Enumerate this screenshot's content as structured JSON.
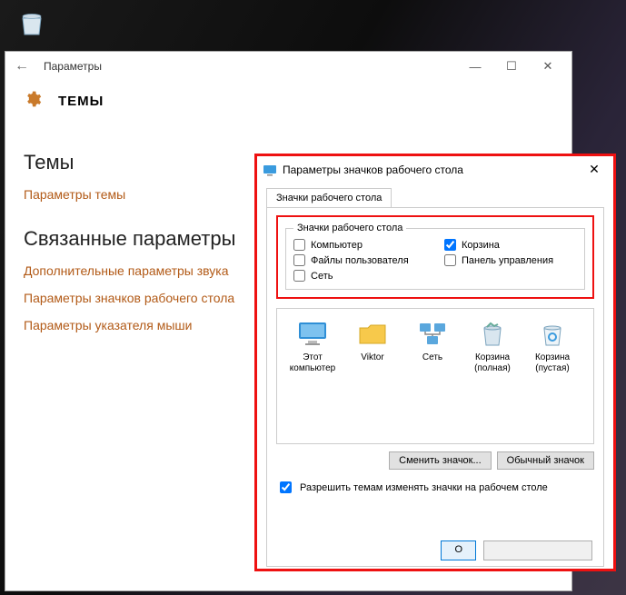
{
  "desktop": {
    "recycle_bin_label": "Корзина"
  },
  "settings": {
    "titlebar": {
      "title": "Параметры"
    },
    "header": "ТЕМЫ",
    "section1_title": "Темы",
    "link_theme_params": "Параметры темы",
    "section2_title": "Связанные параметры",
    "link_sound": "Дополнительные параметры звука",
    "link_desktop_icons": "Параметры значков рабочего стола",
    "link_pointer": "Параметры указателя мыши"
  },
  "dialog": {
    "title": "Параметры значков рабочего стола",
    "tab": "Значки рабочего стола",
    "group_legend": "Значки рабочего стола",
    "cb_computer": "Компьютер",
    "cb_recycle": "Корзина",
    "cb_userfiles": "Файлы пользователя",
    "cb_control": "Панель управления",
    "cb_network": "Сеть",
    "icons": {
      "this_pc": "Этот компьютер",
      "user": "Viktor",
      "network": "Сеть",
      "recycle_full": "Корзина (полная)",
      "recycle_empty": "Корзина (пустая)"
    },
    "btn_change": "Сменить значок...",
    "btn_default": "Обычный значок",
    "allow_themes": "Разрешить темам изменять значки на рабочем столе",
    "btn_ok_partial": "О"
  }
}
